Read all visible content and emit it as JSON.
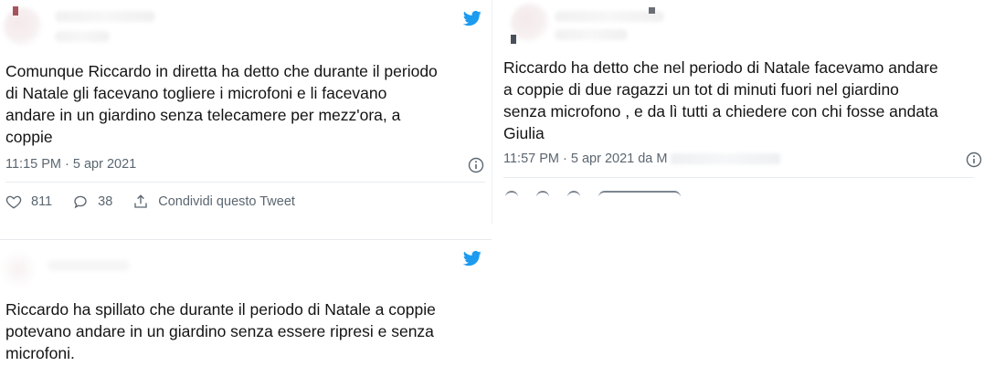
{
  "tweets": [
    {
      "text": "Comunque Riccardo in diretta ha detto che durante il periodo\ndi Natale gli facevano togliere i microfoni e li facevano\nandare in un giardino senza telecamere per mezz'ora, a\ncoppie",
      "timestamp": "11:15 PM · 5 apr 2021",
      "likes": "811",
      "replies": "38",
      "share_label": "Condividi questo Tweet"
    },
    {
      "text": "Riccardo ha detto che nel periodo di Natale facevamo andare\na coppie di due ragazzi un tot di minuti fuori nel giardino\nsenza microfono , e da lì tutti a chiedere con chi fosse andata\nGiulia",
      "timestamp": "11:57 PM · 5 apr 2021 da M"
    },
    {
      "text": "Riccardo ha spillato che durante il periodo di Natale a coppie\npotevano andare in un giardino senza essere ripresi e senza\nmicrofoni."
    }
  ],
  "icons": {
    "brand": "twitter-bird-icon",
    "info": "info-icon",
    "like": "heart-icon",
    "reply": "reply-icon",
    "share": "share-icon"
  },
  "colors": {
    "twitter_blue": "#1d9bf0",
    "meta_gray": "#5b6670"
  }
}
